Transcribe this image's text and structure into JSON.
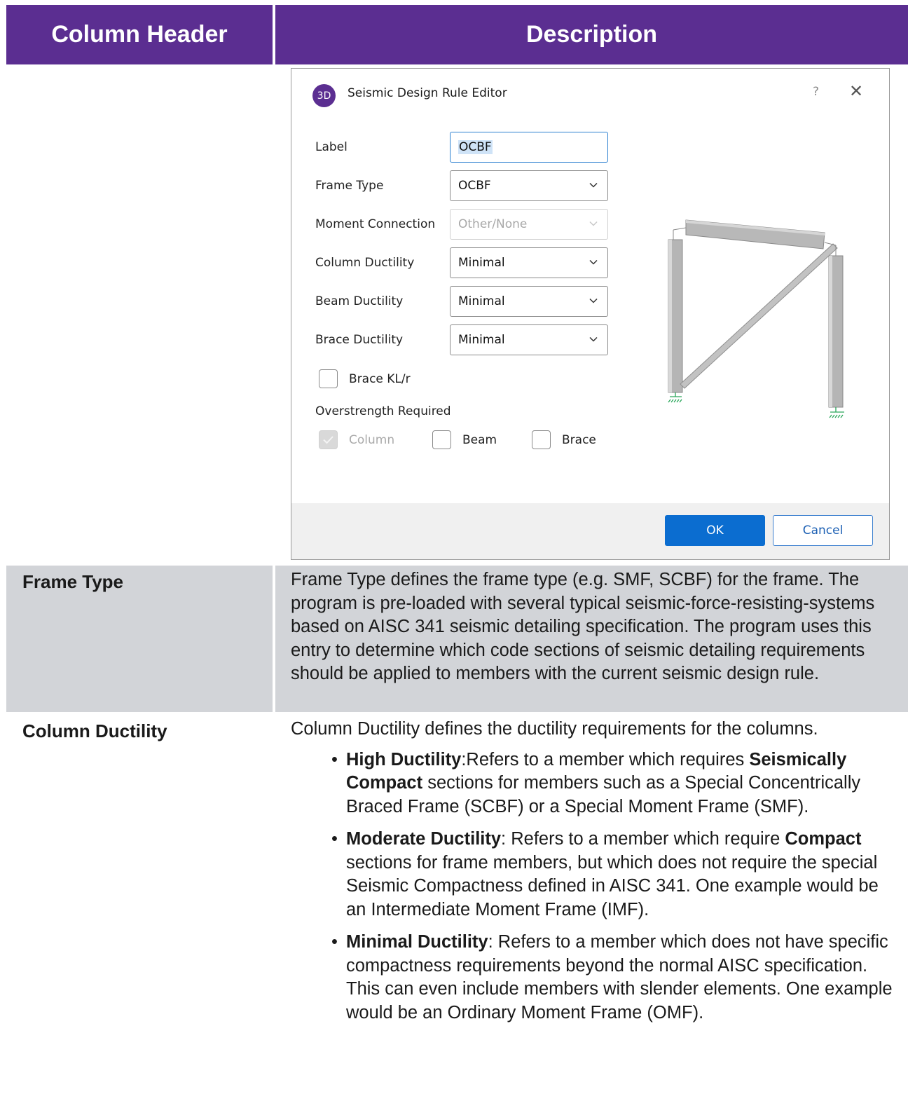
{
  "table": {
    "headers": [
      "Column Header",
      "Description"
    ]
  },
  "dialog": {
    "app_badge": "3D",
    "title": "Seismic Design Rule Editor",
    "help": "?",
    "close": "✕",
    "fields": {
      "label": {
        "label": "Label",
        "value": "OCBF"
      },
      "frame_type": {
        "label": "Frame Type",
        "value": "OCBF"
      },
      "moment_connection": {
        "label": "Moment Connection",
        "value": "Other/None"
      },
      "column_ductility": {
        "label": "Column Ductility",
        "value": "Minimal"
      },
      "beam_ductility": {
        "label": "Beam Ductility",
        "value": "Minimal"
      },
      "brace_ductility": {
        "label": "Brace Ductility",
        "value": "Minimal"
      }
    },
    "brace_klr": {
      "label": "Brace KL/r",
      "checked": false
    },
    "overstrength": {
      "heading": "Overstrength Required",
      "column": {
        "label": "Column",
        "checked": true,
        "disabled": true
      },
      "beam": {
        "label": "Beam",
        "checked": false
      },
      "brace": {
        "label": "Brace",
        "checked": false
      }
    },
    "ok_label": "OK",
    "cancel_label": "Cancel",
    "colors": {
      "accent": "#0b6dd0",
      "brand": "#5b2e91"
    }
  },
  "rows": {
    "frame_type": {
      "label": "Frame Type",
      "description": "Frame Type defines the frame type (e.g. SMF, SCBF) for the frame. The program is pre-loaded with several typical seismic-force-resisting-systems based on AISC 341 seismic detailing specification. The program uses this entry to determine which code sections of seismic detailing requirements should be applied to members with the current seismic design rule."
    },
    "column_ductility": {
      "label": "Column Ductility",
      "intro": "Column Ductility defines the ductility requirements for the columns.",
      "bullets": [
        {
          "bold": "High Ductility",
          "text1": ":Refers to a member which requires ",
          "bold2": "Seismically Compact",
          "text2": " sections for members such as a Special Concentrically Braced Frame (SCBF) or a Special Moment Frame (SMF)."
        },
        {
          "bold": "Moderate Ductility",
          "text1": ": Refers to a member which require ",
          "bold2": "Compact",
          "text2": " sections for frame members, but which does not require the special Seismic Compactness defined in AISC 341. One example would be an Intermediate Moment Frame (IMF)."
        },
        {
          "bold": "Minimal Ductility",
          "text1": ": Refers to a member which does not have specific compactness requirements beyond the normal AISC specification. This can even include members with slender elements. One example would be an Ordinary Moment Frame (OMF)."
        }
      ]
    }
  },
  "theme": {
    "header_bg": "#5b2e91",
    "row_gray": "#d2d4d8"
  }
}
